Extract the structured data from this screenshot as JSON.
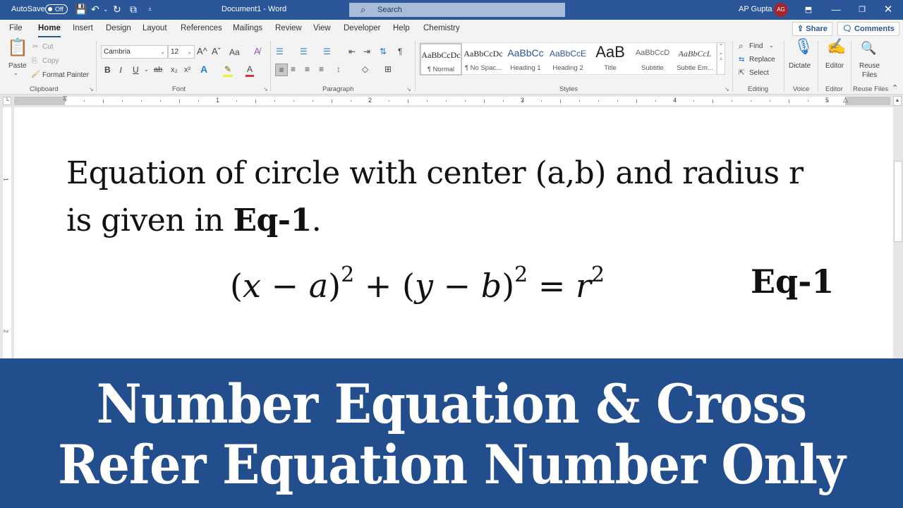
{
  "titlebar": {
    "autosave_label": "AutoSave",
    "autosave_state": "Off",
    "document_title": "Document1  -  Word",
    "search_placeholder": "Search",
    "user_name": "AP Gupta",
    "user_initials": "AG",
    "accent_color": "#2b579a"
  },
  "tabs": [
    {
      "label": "File"
    },
    {
      "label": "Home",
      "active": true
    },
    {
      "label": "Insert"
    },
    {
      "label": "Design"
    },
    {
      "label": "Layout"
    },
    {
      "label": "References"
    },
    {
      "label": "Mailings"
    },
    {
      "label": "Review"
    },
    {
      "label": "View"
    },
    {
      "label": "Developer"
    },
    {
      "label": "Help"
    },
    {
      "label": "Chemistry"
    }
  ],
  "tabbar_actions": {
    "share": "Share",
    "comments": "Comments"
  },
  "ribbon": {
    "clipboard": {
      "label": "Clipboard",
      "paste": "Paste",
      "cut": "Cut",
      "copy": "Copy",
      "format_painter": "Format Painter"
    },
    "font": {
      "label": "Font",
      "font_name": "Cambria",
      "font_size": "12",
      "bold": "B",
      "italic": "I",
      "underline": "U",
      "strikethrough": "ab",
      "subscript": "x₂",
      "superscript": "x²",
      "grow": "A^",
      "shrink": "Aˇ",
      "change_case": "Aa"
    },
    "paragraph": {
      "label": "Paragraph"
    },
    "styles": {
      "label": "Styles",
      "items": [
        {
          "preview": "AaBbCcDc",
          "name": "¶ Normal",
          "selected": true
        },
        {
          "preview": "AaBbCcDc",
          "name": "¶ No Spac..."
        },
        {
          "preview": "AaBbCc",
          "name": "Heading 1"
        },
        {
          "preview": "AaBbCcE",
          "name": "Heading 2"
        },
        {
          "preview": "AaB",
          "name": "Title"
        },
        {
          "preview": "AaBbCcD",
          "name": "Subtitle"
        },
        {
          "preview": "AaBbCcL",
          "name": "Subtle Em..."
        }
      ]
    },
    "editing": {
      "label": "Editing",
      "find": "Find",
      "replace": "Replace",
      "select": "Select"
    },
    "voice": {
      "label": "Voice",
      "dictate": "Dictate"
    },
    "editor": {
      "label": "Editor",
      "editor": "Editor"
    },
    "reuse_files": {
      "label": "Reuse Files",
      "reuse_line1": "Reuse",
      "reuse_line2": "Files"
    }
  },
  "ruler": {
    "numbers": [
      "1",
      "2",
      "3",
      "4",
      "5"
    ]
  },
  "vruler": {
    "numbers": [
      "1",
      "2"
    ]
  },
  "document": {
    "paragraph_line1": "Equation of circle with center (a,b) and radius r",
    "paragraph_line2_prefix": "is given in ",
    "paragraph_ref": "Eq-1",
    "paragraph_suffix": ".",
    "equation": {
      "open1": "(",
      "x": "x",
      "minus1": " − ",
      "a": "a",
      "close1": ")",
      "exp1": "2",
      "plus": " + ",
      "open2": "(",
      "y": "y",
      "minus2": " − ",
      "b": "b",
      "close2": ")",
      "exp2": "2",
      "equals": " = ",
      "r": "r",
      "exp3": "2"
    },
    "equation_label": "Eq-1"
  },
  "banner": {
    "line1": "Number Equation & Cross",
    "line2": "Refer Equation Number Only",
    "background_color": "#234e8d"
  }
}
